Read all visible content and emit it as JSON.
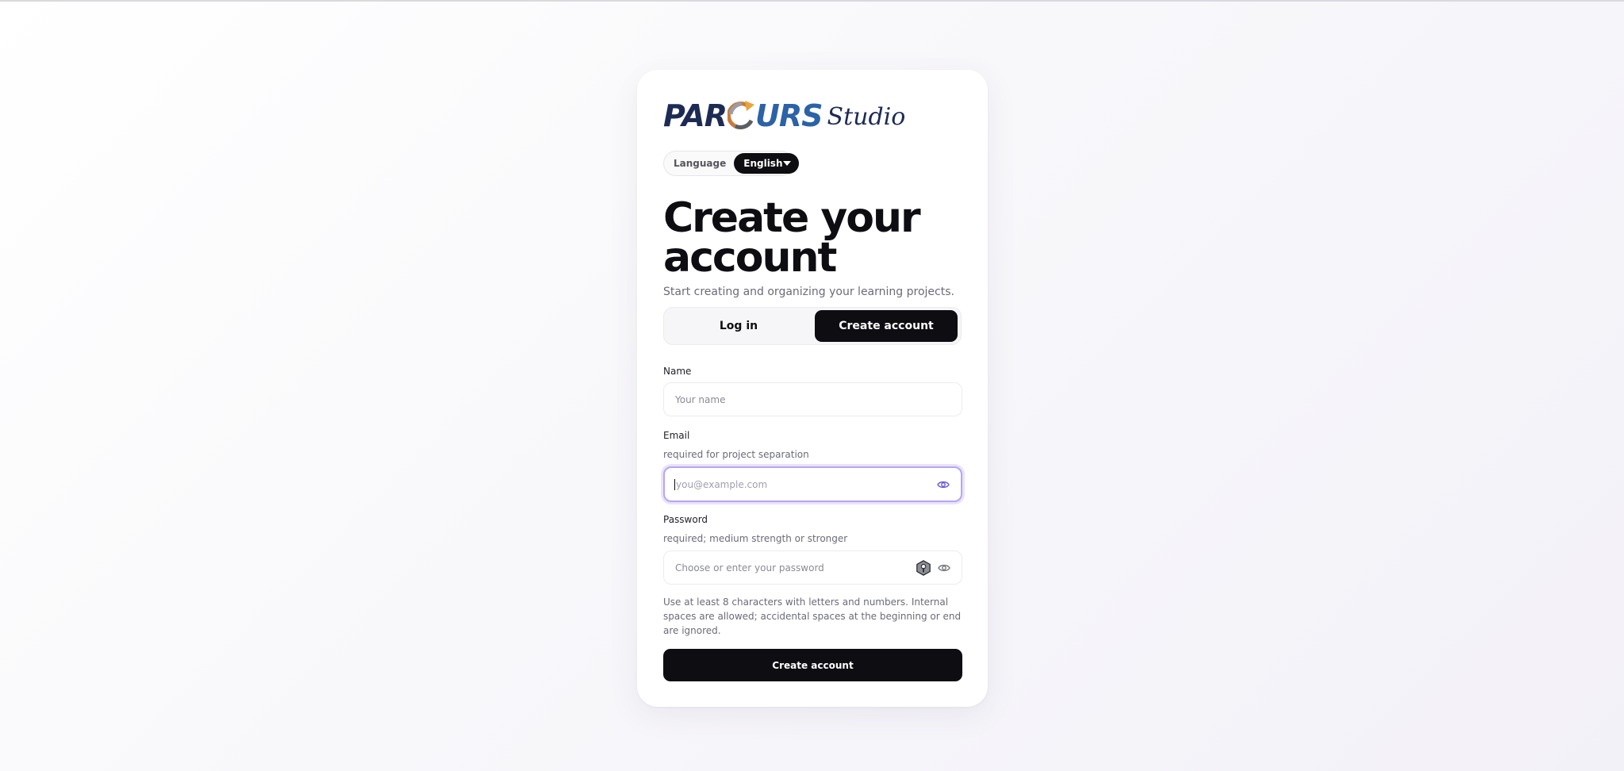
{
  "brand": {
    "logo_text": "PARCOURS",
    "logo_suffix": "Studio"
  },
  "language": {
    "label": "Language",
    "selected": "English"
  },
  "heading": {
    "title": "Create your account",
    "subtitle": "Start creating and organizing your learning projects."
  },
  "tabs": {
    "login": "Log in",
    "create": "Create account",
    "active": "create"
  },
  "form": {
    "name": {
      "label": "Name",
      "placeholder": "Your name",
      "value": ""
    },
    "email": {
      "label": "Email",
      "hint": "required for project separation",
      "placeholder": "you@example.com",
      "value": ""
    },
    "password": {
      "label": "Password",
      "hint": "required; medium strength or stronger",
      "placeholder": "Choose or enter your password",
      "value": ""
    },
    "password_help": "Use at least 8 characters with letters and numbers. Internal spaces are allowed; accidental spaces at the beginning or end are ignored.",
    "submit_label": "Create account"
  },
  "icons": {
    "email_field": "eye-icon",
    "password_generate": "key-shield-icon",
    "password_toggle": "eye-icon"
  },
  "colors": {
    "primary": "#0d0d12",
    "focus_ring": "#b7a5f3",
    "logo_blue": "#1d2b54",
    "accent_purple": "#6b5bd6"
  }
}
